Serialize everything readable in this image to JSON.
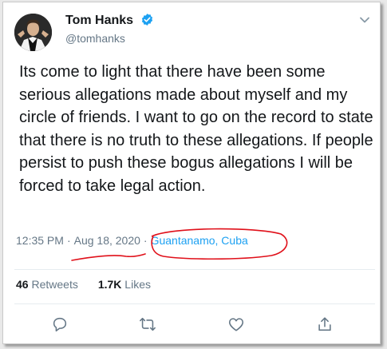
{
  "tweet": {
    "display_name": "Tom Hanks",
    "handle": "@tomhanks",
    "text": "Its come to light that there have been some serious allegations made about myself and my circle of friends. I want to go on the record to state that there is no truth to these allegations. If people persist to push these bogus allegations I will be forced to take legal action.",
    "time": "12:35 PM",
    "separator": "·",
    "date": "Aug 18, 2020",
    "location": "Guantanamo, Cuba",
    "retweets_count": "46",
    "retweets_label": "Retweets",
    "likes_count": "1.7K",
    "likes_label": "Likes"
  },
  "icons": {
    "verified": "verified-badge-icon",
    "caret": "chevron-down-icon",
    "reply": "reply-icon",
    "retweet": "retweet-icon",
    "like": "heart-icon",
    "share": "share-icon"
  },
  "colors": {
    "text": "#14171a",
    "secondary": "#657786",
    "link": "#1da1f2",
    "annotation": "#e0101a"
  }
}
